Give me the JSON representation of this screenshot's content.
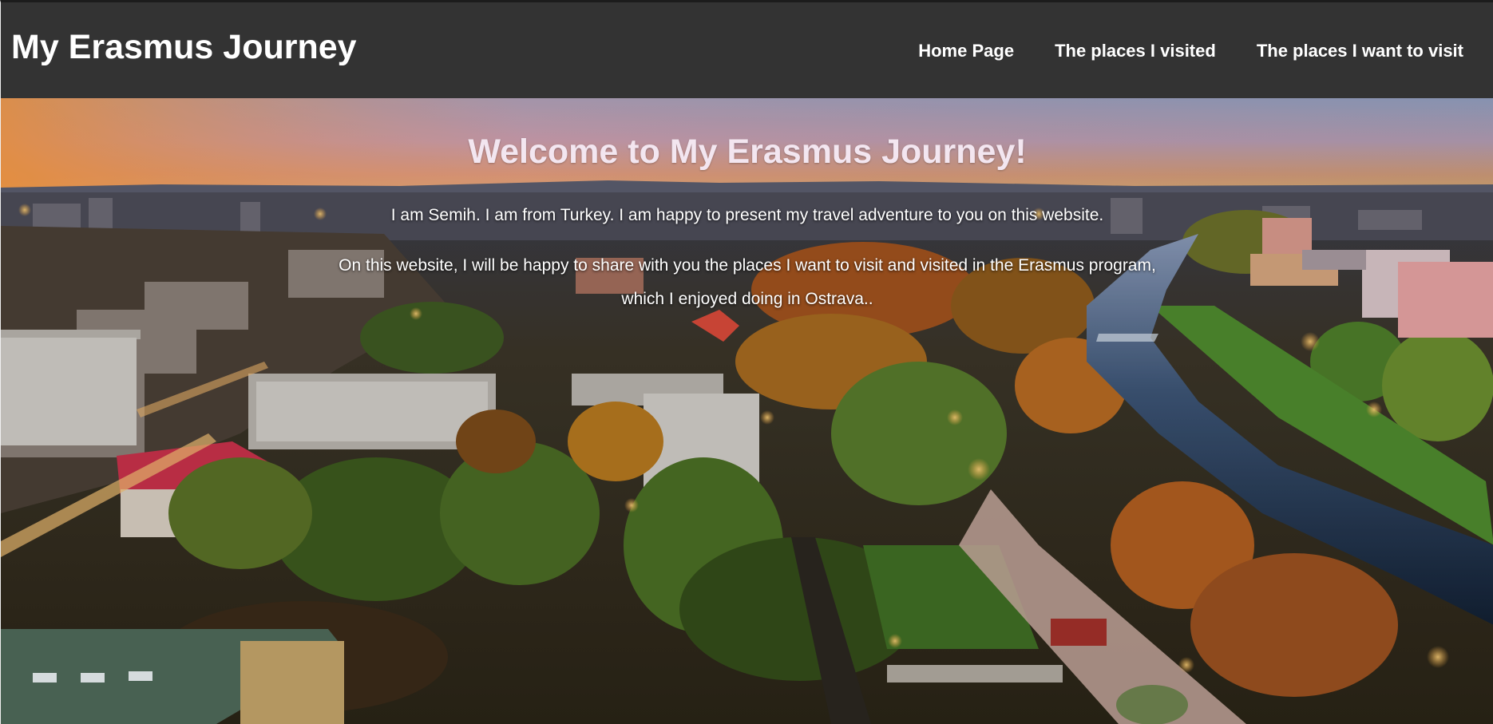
{
  "header": {
    "brand": "My Erasmus Journey",
    "nav": [
      {
        "label": "Home Page"
      },
      {
        "label": "The places I visited"
      },
      {
        "label": "The places I want to visit"
      }
    ]
  },
  "hero": {
    "title": "Welcome to My Erasmus Journey!",
    "intro": "I am Semih. I am from Turkey. I am happy to present my travel adventure to you on this website.",
    "line1": "On this website, I will be happy to share with you the places I want to visit and visited in the Erasmus program,",
    "line2": "which I enjoyed doing in Ostrava.."
  },
  "colors": {
    "navbar": "#333333",
    "nav_text": "#ffffff",
    "title_text": "#f3e6f0"
  }
}
